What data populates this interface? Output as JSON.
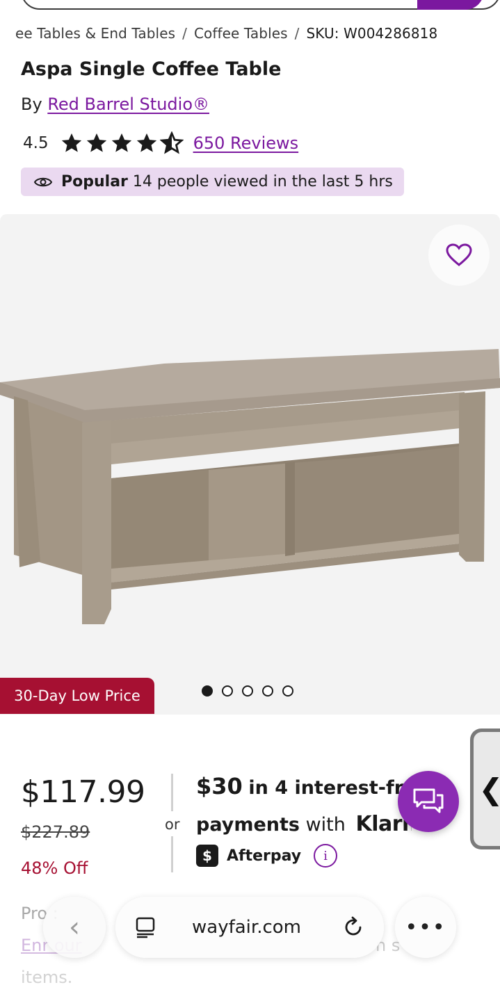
{
  "breadcrumb": {
    "item1": "ee Tables & End Tables",
    "item2": "Coffee Tables",
    "sku": "SKU: W004286818",
    "separator": "/"
  },
  "product": {
    "title": "Aspa Single Coffee Table",
    "by_label": "By",
    "brand": "Red Barrel Studio®",
    "rating": "4.5",
    "rating_value": 4.5,
    "rating_max": 5,
    "reviews": "650 Reviews",
    "popular_label": "Popular",
    "popular_text": "14 people viewed in the last 5 hrs"
  },
  "gallery": {
    "badge": "30-Day Low Price",
    "image_count": 5,
    "active_index": 0
  },
  "pricing": {
    "price": "$117.99",
    "old_price": "$227.89",
    "discount": "48% Off",
    "or": "or",
    "installment_amount": "$30",
    "installment_text": "in 4 interest-fr",
    "payments_word": "payments",
    "with_word": "with",
    "klarna": "Klarna",
    "afterpay": "Afterpay"
  },
  "promo": {
    "line1": "Pro      :",
    "line2": "Enr    our",
    "line2_tail": "n s",
    "line3": "items."
  },
  "browser": {
    "url": "wayfair.com",
    "more": "•••",
    "back": "‹"
  },
  "side_tab": {
    "glyph": "❮"
  },
  "colors": {
    "brand_purple": "#7b189f",
    "badge_red": "#a61032",
    "popular_bg": "#ead9f0",
    "chat_purple": "#8b2bb3"
  },
  "icons": {
    "heart": "heart-icon",
    "eye": "eye-icon",
    "star": "star-icon",
    "chat": "chat-icon",
    "info": "info-icon",
    "afterpay": "afterpay-icon",
    "tabs": "tabs-icon",
    "reload": "reload-icon"
  }
}
